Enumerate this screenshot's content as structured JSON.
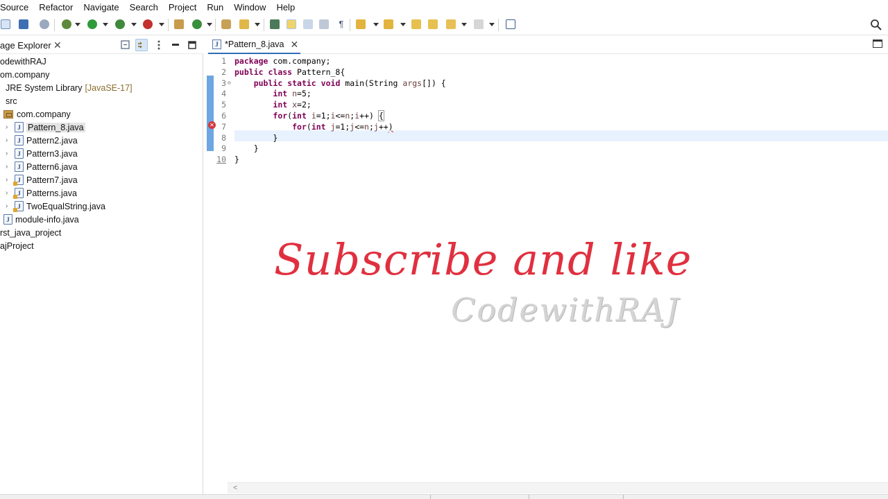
{
  "menu": [
    "Source",
    "Refactor",
    "Navigate",
    "Search",
    "Project",
    "Run",
    "Window",
    "Help"
  ],
  "explorer": {
    "title": "age Explorer",
    "tree": [
      {
        "label": "odewithRAJ",
        "indent": 0,
        "icon": "none"
      },
      {
        "label": "om.company",
        "indent": 0,
        "icon": "none"
      },
      {
        "label": "JRE System Library",
        "suffix": "[JavaSE-17]",
        "indent": 8,
        "icon": "none"
      },
      {
        "label": "src",
        "indent": 8,
        "icon": "none"
      },
      {
        "label": "com.company",
        "indent": 5,
        "icon": "package"
      },
      {
        "label": "Pattern_8.java",
        "indent": 8,
        "icon": "java",
        "chevron": true,
        "selected": true
      },
      {
        "label": "Pattern2.java",
        "indent": 8,
        "icon": "java",
        "chevron": true
      },
      {
        "label": "Pattern3.java",
        "indent": 8,
        "icon": "java",
        "chevron": true
      },
      {
        "label": "Pattern6.java",
        "indent": 8,
        "icon": "java",
        "chevron": true
      },
      {
        "label": "Pattern7.java",
        "indent": 8,
        "icon": "java-warn",
        "chevron": true
      },
      {
        "label": "Patterns.java",
        "indent": 8,
        "icon": "java-warn",
        "chevron": true
      },
      {
        "label": "TwoEqualString.java",
        "indent": 8,
        "icon": "java-warn",
        "chevron": true
      },
      {
        "label": "module-info.java",
        "indent": 5,
        "icon": "java"
      },
      {
        "label": "rst_java_project",
        "indent": 0,
        "icon": "none"
      },
      {
        "label": "ajProject",
        "indent": 0,
        "icon": "none"
      }
    ]
  },
  "editor": {
    "tab_label": "*Pattern_8.java",
    "lines": [
      {
        "n": "1",
        "tokens": [
          {
            "t": "kw",
            "v": "package"
          },
          {
            "t": "p",
            "v": " com.company;"
          }
        ]
      },
      {
        "n": "2",
        "tokens": [
          {
            "t": "kw",
            "v": "public"
          },
          {
            "t": "p",
            "v": " "
          },
          {
            "t": "kw",
            "v": "class"
          },
          {
            "t": "p",
            "v": " Pattern_8{"
          }
        ]
      },
      {
        "n": "3",
        "fold": "⊖",
        "tokens": [
          {
            "t": "p",
            "v": "    "
          },
          {
            "t": "kw",
            "v": "public"
          },
          {
            "t": "p",
            "v": " "
          },
          {
            "t": "kw",
            "v": "static"
          },
          {
            "t": "p",
            "v": " "
          },
          {
            "t": "kw",
            "v": "void"
          },
          {
            "t": "p",
            "v": " main(String "
          },
          {
            "t": "var",
            "v": "args"
          },
          {
            "t": "p",
            "v": "[]) {"
          }
        ]
      },
      {
        "n": "4",
        "tokens": [
          {
            "t": "p",
            "v": "        "
          },
          {
            "t": "kw",
            "v": "int"
          },
          {
            "t": "p",
            "v": " "
          },
          {
            "t": "var",
            "v": "n"
          },
          {
            "t": "p",
            "v": "=5;"
          }
        ]
      },
      {
        "n": "5",
        "tokens": [
          {
            "t": "p",
            "v": "        "
          },
          {
            "t": "kw",
            "v": "int"
          },
          {
            "t": "p",
            "v": " "
          },
          {
            "t": "var",
            "v": "x"
          },
          {
            "t": "p",
            "v": "=2;"
          }
        ]
      },
      {
        "n": "6",
        "tokens": [
          {
            "t": "p",
            "v": "        "
          },
          {
            "t": "kw",
            "v": "for"
          },
          {
            "t": "p",
            "v": "("
          },
          {
            "t": "kw",
            "v": "int"
          },
          {
            "t": "p",
            "v": " "
          },
          {
            "t": "var",
            "v": "i"
          },
          {
            "t": "p",
            "v": "=1;"
          },
          {
            "t": "var",
            "v": "i"
          },
          {
            "t": "p",
            "v": "<="
          },
          {
            "t": "var",
            "v": "n"
          },
          {
            "t": "p",
            "v": ";"
          },
          {
            "t": "var",
            "v": "i"
          },
          {
            "t": "p",
            "v": "++) "
          },
          {
            "t": "box",
            "v": "{"
          }
        ]
      },
      {
        "n": "7",
        "tokens": [
          {
            "t": "p",
            "v": "            "
          },
          {
            "t": "kw",
            "v": "for"
          },
          {
            "t": "p",
            "v": "("
          },
          {
            "t": "kw",
            "v": "int"
          },
          {
            "t": "p",
            "v": " "
          },
          {
            "t": "var",
            "v": "j"
          },
          {
            "t": "p",
            "v": "=1;"
          },
          {
            "t": "var",
            "v": "j"
          },
          {
            "t": "p",
            "v": "<="
          },
          {
            "t": "var",
            "v": "n"
          },
          {
            "t": "p",
            "v": ";"
          },
          {
            "t": "var",
            "v": "j"
          },
          {
            "t": "p",
            "v": "++"
          },
          {
            "t": "err",
            "v": ")"
          }
        ]
      },
      {
        "n": "8",
        "tokens": [
          {
            "t": "p",
            "v": "        }"
          }
        ]
      },
      {
        "n": "9",
        "tokens": [
          {
            "t": "p",
            "v": "    }"
          }
        ]
      },
      {
        "n": "10",
        "underline": true,
        "tokens": [
          {
            "t": "p",
            "v": "}"
          }
        ]
      }
    ]
  },
  "overlay": {
    "headline": "Subscribe and like",
    "watermark": "CodewithRAJ"
  },
  "colors": {
    "keyword": "#7f0055",
    "overlay_red": "#e0303f",
    "selection_blue": "#4a90d9"
  }
}
